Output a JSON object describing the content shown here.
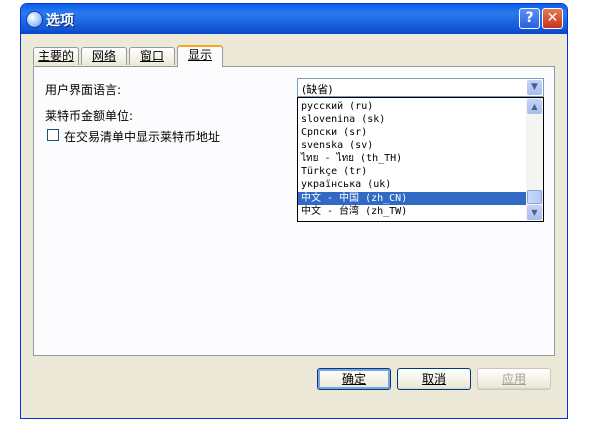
{
  "window": {
    "title": "选项"
  },
  "tabs": [
    {
      "label": "主要的"
    },
    {
      "label": "网络"
    },
    {
      "label": "窗口"
    },
    {
      "label": "显示"
    }
  ],
  "display": {
    "language_label": "用户界面语言:",
    "unit_label": "莱特币金额单位:",
    "show_addresses_label": "在交易清单中显示莱特币地址"
  },
  "language_combo": {
    "value": "(缺省)"
  },
  "language_options": [
    "русский (ru)",
    "slovenina (sk)",
    "Српски (sr)",
    "svenska (sv)",
    "ไทย - ไทย (th_TH)",
    "Türkçe (tr)",
    "українська (uk)",
    "中文 - 中国 (zh_CN)",
    "中文 - 台湾 (zh_TW)"
  ],
  "selected_option": "中文 - 中国 (zh_CN)",
  "buttons": {
    "ok": "确定",
    "cancel": "取消",
    "apply": "应用"
  },
  "colors": {
    "titlebar": "#0a5ee8",
    "selection": "#316ac5",
    "window_bg": "#ece9d8"
  }
}
